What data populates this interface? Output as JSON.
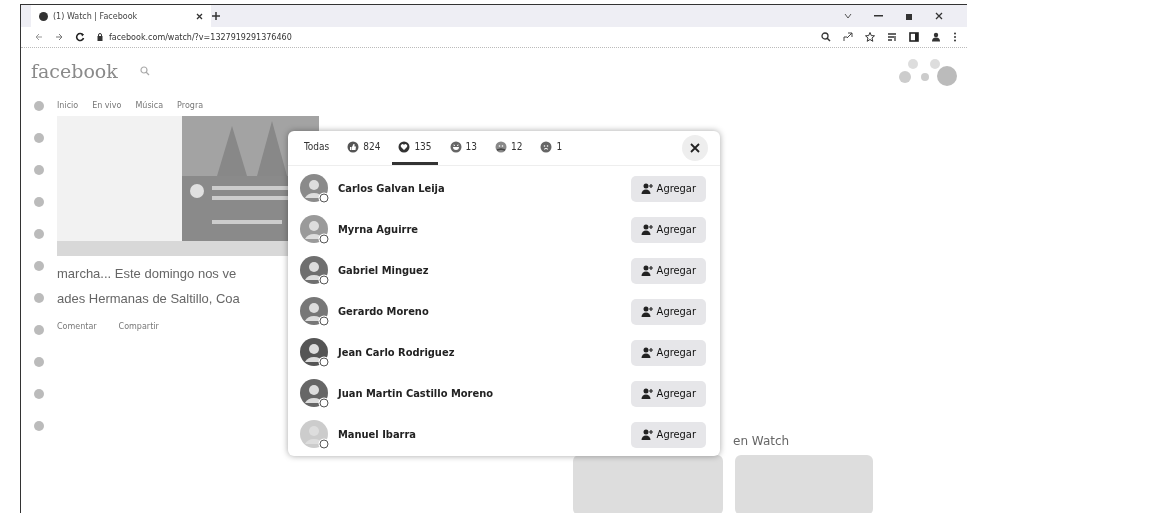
{
  "browser": {
    "tab_title": "(1) Watch | Facebook",
    "url": "facebook.com/watch/?v=1327919291376460"
  },
  "page": {
    "logo": "facebook",
    "nav": [
      "Inicio",
      "En vivo",
      "Música",
      "Progra"
    ],
    "post_lines": [
      "marcha... Este domingo nos ve",
      "ades Hermanas de Saltillo, Coa"
    ],
    "actions": [
      "Comentar",
      "Compartir"
    ],
    "section_heading": "en Watch"
  },
  "reactions_dialog": {
    "tabs": [
      {
        "kind": "all",
        "label": "Todas",
        "selected": false
      },
      {
        "kind": "like",
        "label": "824",
        "selected": false
      },
      {
        "kind": "love",
        "label": "135",
        "selected": true
      },
      {
        "kind": "haha",
        "label": "13",
        "selected": false
      },
      {
        "kind": "care",
        "label": "12",
        "selected": false
      },
      {
        "kind": "sad",
        "label": "1",
        "selected": false
      }
    ],
    "people": [
      {
        "name": "Carlos Galvan Leija",
        "action": "Agregar"
      },
      {
        "name": "Myrna Aguirre",
        "action": "Agregar"
      },
      {
        "name": "Gabriel Minguez",
        "action": "Agregar"
      },
      {
        "name": "Gerardo Moreno",
        "action": "Agregar"
      },
      {
        "name": "Jean Carlo Rodriguez",
        "action": "Agregar"
      },
      {
        "name": "Juan Martin Castillo Moreno",
        "action": "Agregar"
      },
      {
        "name": "Manuel Ibarra",
        "action": "Agregar"
      }
    ]
  }
}
